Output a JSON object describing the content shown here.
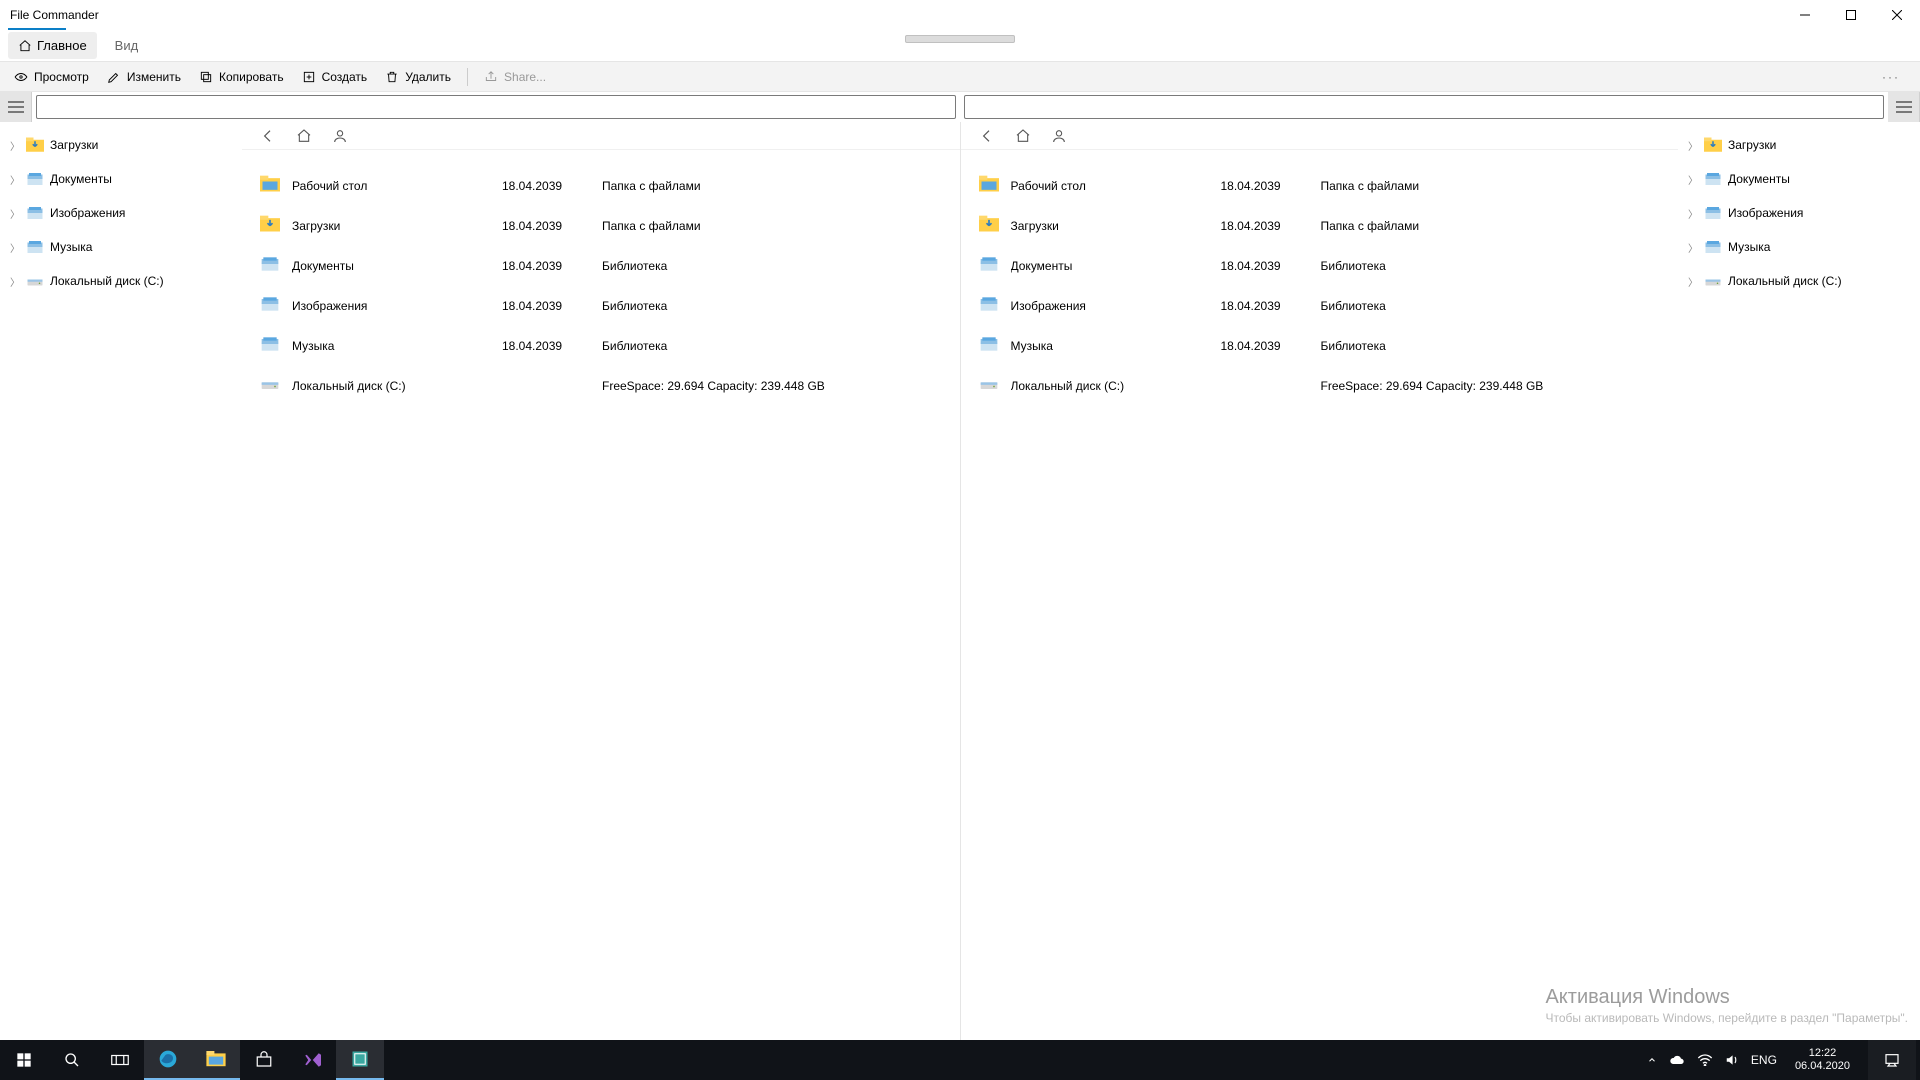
{
  "app": {
    "title": "File Commander"
  },
  "window_controls": {
    "min": "—",
    "max": "▢",
    "close": "✕"
  },
  "tabs": {
    "main": "Главное",
    "view": "Вид"
  },
  "toolbar": {
    "view": "Просмотр",
    "edit": "Изменить",
    "copy": "Копировать",
    "create": "Создать",
    "delete": "Удалить",
    "share": "Share...",
    "overflow": "···"
  },
  "tree": {
    "downloads": "Загрузки",
    "documents": "Документы",
    "pictures": "Изображения",
    "music": "Музыка",
    "localdisk": "Локальный диск (C:)"
  },
  "list": [
    {
      "icon": "desktop",
      "name": "Рабочий стол",
      "date": "18.04.2039",
      "type": "Папка с файлами"
    },
    {
      "icon": "downloads",
      "name": "Загрузки",
      "date": "18.04.2039",
      "type": "Папка с файлами"
    },
    {
      "icon": "library",
      "name": "Документы",
      "date": "18.04.2039",
      "type": "Библиотека"
    },
    {
      "icon": "library",
      "name": "Изображения",
      "date": "18.04.2039",
      "type": "Библиотека"
    },
    {
      "icon": "library",
      "name": "Музыка",
      "date": "18.04.2039",
      "type": "Библиотека"
    },
    {
      "icon": "drive",
      "name": "Локальный диск (C:)",
      "date": "",
      "type": "FreeSpace: 29.694 Capacity:  239.448 GB"
    }
  ],
  "watermark": {
    "title": "Активация Windows",
    "text": "Чтобы активировать Windows, перейдите в раздел \"Параметры\"."
  },
  "taskbar": {
    "lang": "ENG",
    "time": "12:22",
    "date": "06.04.2020"
  }
}
